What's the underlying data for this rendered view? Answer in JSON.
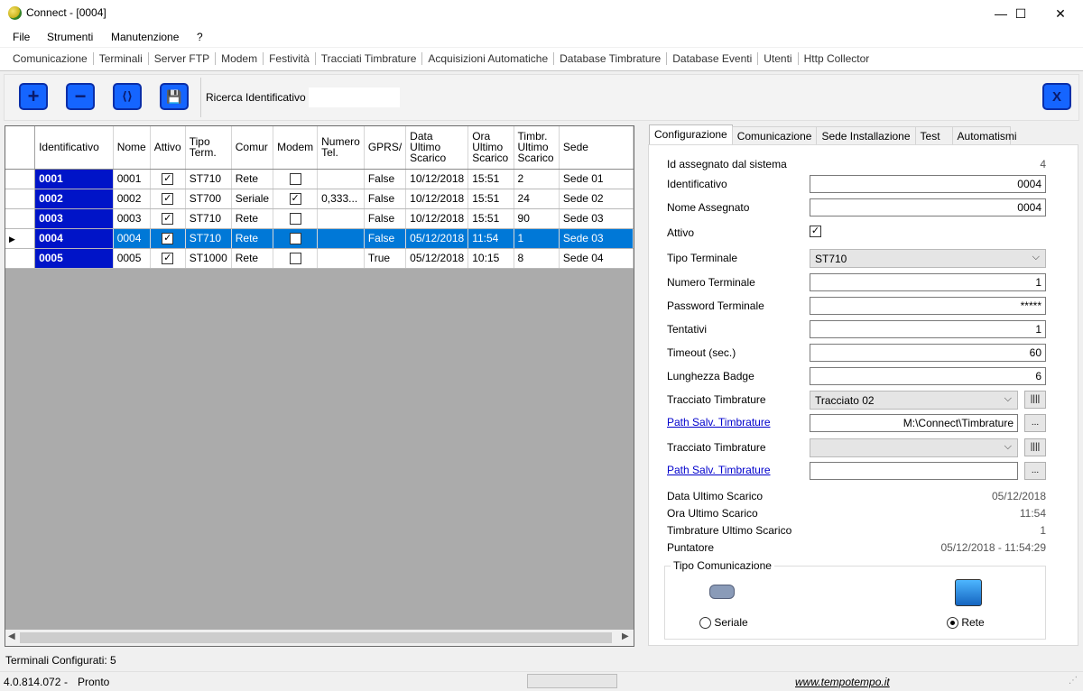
{
  "window": {
    "title": "Connect  - [0004]",
    "min": "—",
    "max": "☐",
    "close": "✕"
  },
  "menu": [
    "File",
    "Strumenti",
    "Manutenzione",
    "?"
  ],
  "nav": [
    "Comunicazione",
    "Terminali",
    "Server FTP",
    "Modem",
    "Festività",
    "Tracciati Timbrature",
    "Acquisizioni Automatiche",
    "Database Timbrature",
    "Database Eventi",
    "Utenti",
    "Http Collector"
  ],
  "toolbar": {
    "add": "+",
    "remove": "−",
    "connect": "⟨⟩",
    "save": "💾",
    "search_label": "Ricerca Identificativo",
    "search_value": "",
    "exit": "X"
  },
  "table": {
    "headers": [
      "Identificativo",
      "Nome",
      "Attivo",
      "Tipo Term.",
      "Comur",
      "Modem",
      "Numero Tel.",
      "GPRS/",
      "Data Ultimo Scarico",
      "Ora Ultimo Scarico",
      "Timbr. Ultimo Scarico",
      "Sede"
    ],
    "rows": [
      {
        "id": "0001",
        "nome": "0001",
        "attivo": true,
        "tipo": "ST710",
        "comun": "Rete",
        "modem": false,
        "tel": "",
        "gprs": "False",
        "data": "10/12/2018",
        "ora": "15:51",
        "timbr": "2",
        "sede": "Sede 01"
      },
      {
        "id": "0002",
        "nome": "0002",
        "attivo": true,
        "tipo": "ST700",
        "comun": "Seriale",
        "modem": true,
        "tel": "0,333...",
        "gprs": "False",
        "data": "10/12/2018",
        "ora": "15:51",
        "timbr": "24",
        "sede": "Sede 02"
      },
      {
        "id": "0003",
        "nome": "0003",
        "attivo": true,
        "tipo": "ST710",
        "comun": "Rete",
        "modem": false,
        "tel": "",
        "gprs": "False",
        "data": "10/12/2018",
        "ora": "15:51",
        "timbr": "90",
        "sede": "Sede 03"
      },
      {
        "id": "0004",
        "nome": "0004",
        "attivo": true,
        "tipo": "ST710",
        "comun": "Rete",
        "modem": false,
        "tel": "",
        "gprs": "False",
        "data": "05/12/2018",
        "ora": "11:54",
        "timbr": "1",
        "sede": "Sede 03",
        "selected": true
      },
      {
        "id": "0005",
        "nome": "0005",
        "attivo": true,
        "tipo": "ST1000",
        "comun": "Rete",
        "modem": false,
        "tel": "",
        "gprs": "True",
        "data": "05/12/2018",
        "ora": "10:15",
        "timbr": "8",
        "sede": "Sede 04"
      }
    ]
  },
  "tabs": [
    "Configurazione",
    "Comunicazione",
    "Sede Installazione",
    "Test",
    "Automatismi"
  ],
  "config": {
    "id_sistema_label": "Id assegnato dal sistema",
    "id_sistema": "4",
    "identificativo_label": "Identificativo",
    "identificativo": "0004",
    "nome_label": "Nome Assegnato",
    "nome": "0004",
    "attivo_label": "Attivo",
    "tipo_label": "Tipo Terminale",
    "tipo": "ST710",
    "numero_label": "Numero Terminale",
    "numero": "1",
    "password_label": "Password Terminale",
    "password": "*****",
    "tentativi_label": "Tentativi",
    "tentativi": "1",
    "timeout_label": "Timeout (sec.)",
    "timeout": "60",
    "badge_label": "Lunghezza Badge",
    "badge": "6",
    "tracciato1_label": "Tracciato Timbrature",
    "tracciato1": "Tracciato 02",
    "path1_label": "Path Salv. Timbrature",
    "path1": "M:\\Connect\\Timbrature",
    "tracciato2_label": "Tracciato Timbrature",
    "tracciato2": "",
    "path2_label": "Path Salv. Timbrature",
    "path2": "",
    "data_label": "Data Ultimo Scarico",
    "data": "05/12/2018",
    "ora_label": "Ora Ultimo Scarico",
    "ora": "11:54",
    "timbr_label": "Timbrature Ultimo Scarico",
    "timbr": "1",
    "puntatore_label": "Puntatore",
    "puntatore": "05/12/2018 - 11:54:29",
    "tipo_com_label": "Tipo Comunicazione",
    "seriale_label": "Seriale",
    "rete_label": "Rete",
    "bars": "||||",
    "dots": "..."
  },
  "status": {
    "configurati": "Terminali Configurati: 5",
    "version": "4.0.814.072",
    "dash": "-",
    "state": "Pronto",
    "site": "www.tempotempo.it"
  }
}
